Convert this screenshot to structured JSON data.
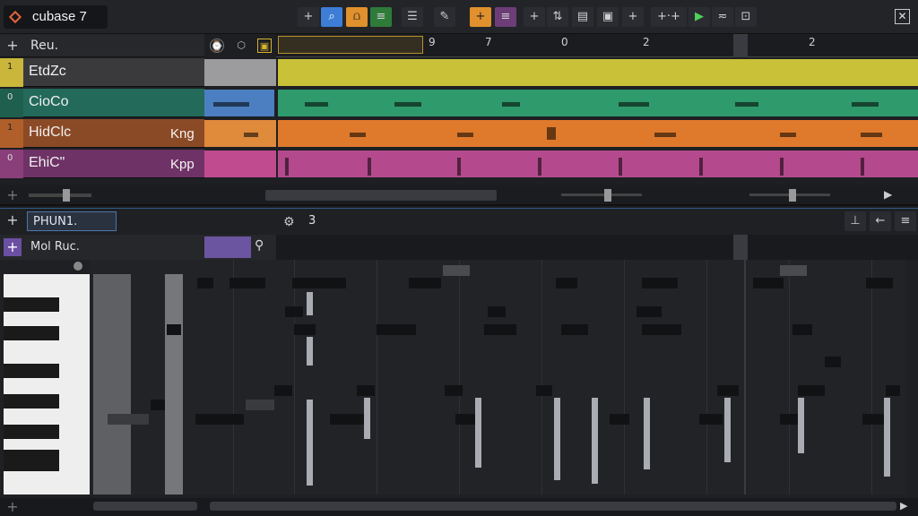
{
  "app": {
    "title": "cubase 7"
  },
  "toolbar": {
    "close_label": "✕"
  },
  "track_header": {
    "label": "Reu."
  },
  "ruler": {
    "marks": [
      "9",
      "7",
      "0",
      "2",
      "2"
    ]
  },
  "tracks": [
    {
      "num": "1",
      "name": "EtdZc",
      "side": "",
      "color": "#c9c138",
      "hdr": "#c9b63a"
    },
    {
      "num": "0",
      "name": "CioCo",
      "side": "",
      "color": "#2f9a6b",
      "hdr": "#2b7a63"
    },
    {
      "num": "1",
      "name": "HidClc",
      "side": "Kng",
      "color": "#df7a2c",
      "hdr": "#b05f2a"
    },
    {
      "num": "0",
      "name": "EhiC\"",
      "side": "Kpp",
      "color": "#b44a8d",
      "hdr": "#8a3f7a"
    }
  ],
  "editor": {
    "title": "PHUN1.",
    "snap_value": "3",
    "instrument": "Mol Ruc."
  }
}
